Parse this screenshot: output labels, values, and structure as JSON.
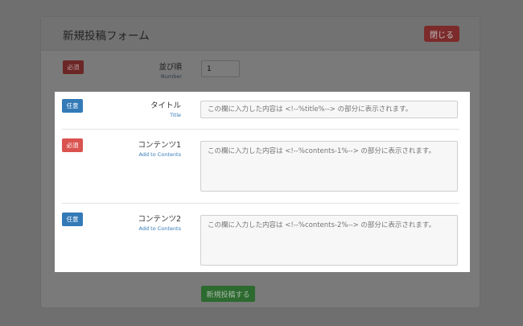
{
  "modal": {
    "title": "新規投稿フォーム",
    "close_label": "閉じる",
    "submit_label": "新規投稿する"
  },
  "fields": {
    "order": {
      "badge": "必須",
      "label": "並び順",
      "sublabel": "Number",
      "value": "1"
    },
    "title": {
      "badge": "任意",
      "label": "タイトル",
      "sublabel": "Title",
      "placeholder": "この欄に入力した内容は <!--%title%--> の部分に表示されます。"
    },
    "contents1": {
      "badge": "必須",
      "label": "コンテンツ1",
      "sublabel": "Add to Contents",
      "placeholder": "この欄に入力した内容は <!--%contents-1%--> の部分に表示されます。"
    },
    "contents2": {
      "badge": "任意",
      "label": "コンテンツ2",
      "sublabel": "Add to Contents",
      "placeholder": "この欄に入力した内容は <!--%contents-2%--> の部分に表示されます。"
    }
  },
  "colors": {
    "overlay": "#6f6f6f",
    "required_badge": "#d9534f",
    "optional_badge": "#337ab7",
    "submit_button": "#5cb85c"
  }
}
